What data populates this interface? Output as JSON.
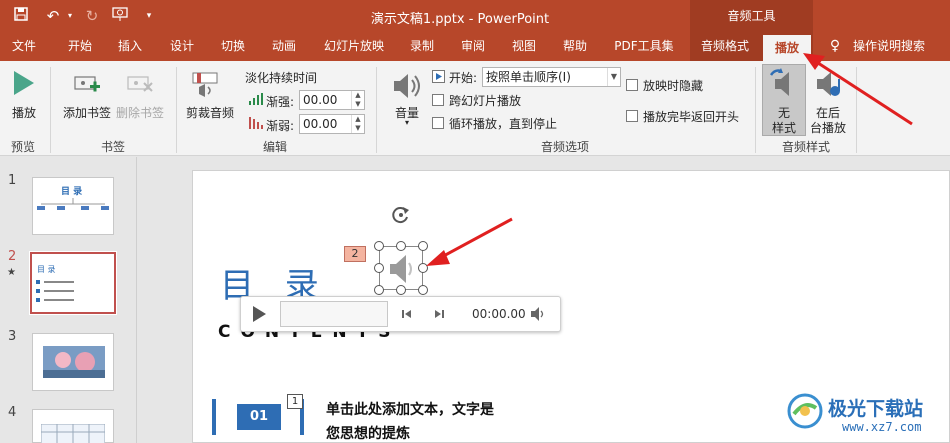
{
  "title_bar": {
    "doc_title": "演示文稿1.pptx  -  PowerPoint",
    "tool_group": "音频工具"
  },
  "tabs": [
    {
      "label": "文件"
    },
    {
      "label": "开始"
    },
    {
      "label": "插入"
    },
    {
      "label": "设计"
    },
    {
      "label": "切换"
    },
    {
      "label": "动画"
    },
    {
      "label": "幻灯片放映"
    },
    {
      "label": "录制"
    },
    {
      "label": "审阅"
    },
    {
      "label": "视图"
    },
    {
      "label": "帮助"
    },
    {
      "label": "PDF工具集"
    },
    {
      "label": "音频格式"
    },
    {
      "label": "播放"
    },
    {
      "label": "操作说明搜索"
    }
  ],
  "ribbon": {
    "play_label": "播放",
    "preview_group": "预览",
    "add_bookmark": "添加书签",
    "remove_bookmark": "删除书签",
    "bookmark_group": "书签",
    "trim_audio": "剪裁音频",
    "fade_duration": "淡化持续时间",
    "fade_in_label": "渐强:",
    "fade_in_value": "00.00",
    "fade_out_label": "渐弱:",
    "fade_out_value": "00.00",
    "edit_group": "编辑",
    "volume_label": "音量",
    "start_label": "开始:",
    "start_value": "按照单击顺序(I)",
    "play_across_slides": "跨幻灯片播放",
    "loop_until_stopped": "循环播放，直到停止",
    "hide_during_show": "放映时隐藏",
    "rewind_after_playing": "播放完毕返回开头",
    "audio_options_group": "音频选项",
    "no_style_line1": "无",
    "no_style_line2": "样式",
    "play_bg_line1": "在后",
    "play_bg_line2": "台播放",
    "audio_styles_group": "音频样式"
  },
  "thumbnails": [
    {
      "num": "1",
      "star": ""
    },
    {
      "num": "2",
      "star": "★"
    },
    {
      "num": "3",
      "star": ""
    },
    {
      "num": "4",
      "star": ""
    }
  ],
  "thumb1_title": "目 录",
  "thumb2_title": "目 录",
  "slide": {
    "title": "目 录",
    "subtitle": "CONTENTS",
    "item_number": "01",
    "item_text_line1": "单击此处添加文本，文字是",
    "item_text_line2": "您思想的提炼",
    "animation_tag": "2",
    "item_tag": "1"
  },
  "player": {
    "time": "00:00.00"
  },
  "watermark": {
    "brand": "极光下载站",
    "url": "www.xz7.com"
  },
  "colors": {
    "accent": "#b7472a",
    "slide_blue": "#2e6db4",
    "arrow_red": "#e02020"
  }
}
